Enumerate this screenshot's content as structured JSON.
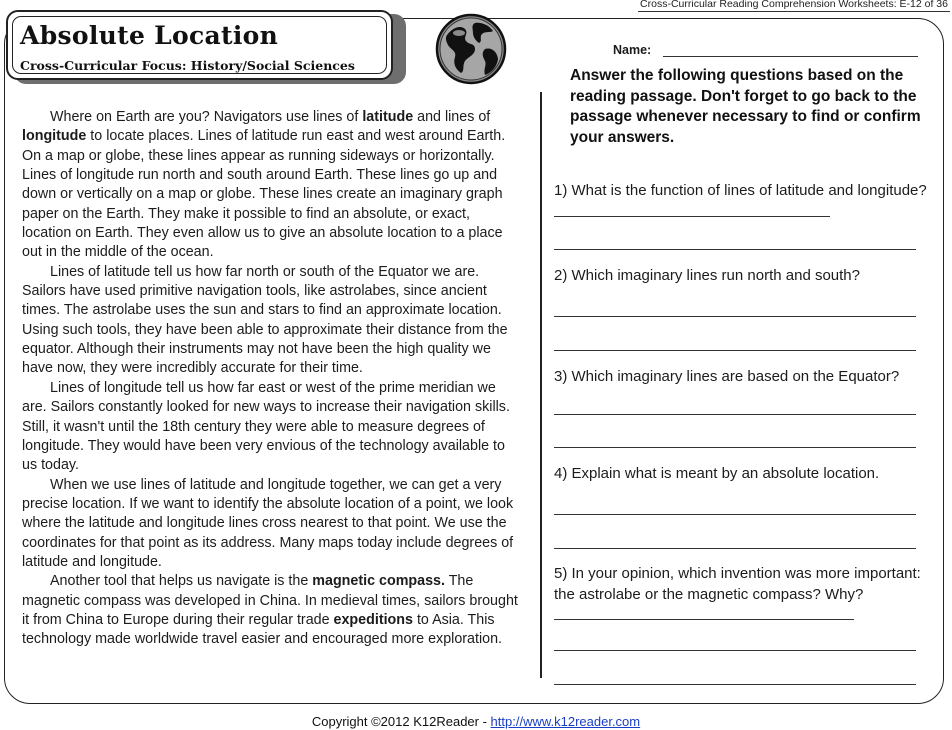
{
  "header": {
    "series": "Cross-Curricular Reading Comprehension Worksheets: E-12 of 36"
  },
  "title": "Absolute Location",
  "subtitle": "Cross-Curricular Focus: History/Social Sciences",
  "globe_icon": "globe-icon",
  "passage": {
    "p1_a": "Where on Earth are you? Navigators use lines of ",
    "p1_b1": "latitude",
    "p1_c": " and lines of ",
    "p1_b2": "longitude",
    "p1_d": " to locate places. Lines of latitude run east and west around Earth. On a map or globe, these lines appear as running sideways or horizontally. Lines of longitude run north and south around Earth. These lines go up and down or vertically on a map or globe.  These lines create an imaginary graph paper on the Earth. They make it possible to find an absolute, or exact, location on Earth. They even allow us to give an absolute location to a place out in the middle of the ocean.",
    "p2": "Lines of latitude tell us how far north or south of the Equator we are. Sailors have used primitive navigation tools, like astrolabes, since ancient times. The astrolabe uses the sun and stars to find an approximate location. Using such tools, they have been able to approximate their distance from the equator. Although their instruments may not have been the high quality we have now, they were incredibly accurate for their time.",
    "p3": "Lines of longitude tell us how far east or west of the prime meridian we are. Sailors constantly looked for new ways to increase their navigation skills. Still, it wasn't until the 18th century they were able to measure degrees of longitude. They would have been very envious of the technology available to us today.",
    "p4": "When we use lines of latitude and longitude together, we can get a very precise location. If we want to identify the absolute location of a point, we look where the latitude and longitude lines cross nearest to that point. We use the coordinates for that point as its address. Many maps today include degrees of latitude and longitude.",
    "p5_a": "Another tool that helps us navigate is the ",
    "p5_b1": "magnetic compass.",
    "p5_c": " The magnetic compass was developed in China. In medieval times, sailors brought it from China to Europe during their regular trade ",
    "p5_b2": "expeditions",
    "p5_d": " to Asia. This technology made worldwide travel easier and encouraged more exploration."
  },
  "name_label": "Name:",
  "instructions": "Answer the following questions based on the  reading passage. Don't forget to go back to the passage whenever necessary to find or confirm your answers.",
  "questions": [
    {
      "text": "1) What is the function of lines of latitude and longitude?"
    },
    {
      "text": "2) Which imaginary lines run north and south?"
    },
    {
      "text": "3) Which imaginary lines are based on the Equator?"
    },
    {
      "text": "4) Explain what is meant by an absolute location."
    },
    {
      "text": "5) In your opinion, which invention was more important: the astrolabe or the magnetic compass? Why?"
    }
  ],
  "footer": {
    "copyright": "Copyright ©2012 K12Reader - ",
    "link": "http://www.k12reader.com"
  }
}
